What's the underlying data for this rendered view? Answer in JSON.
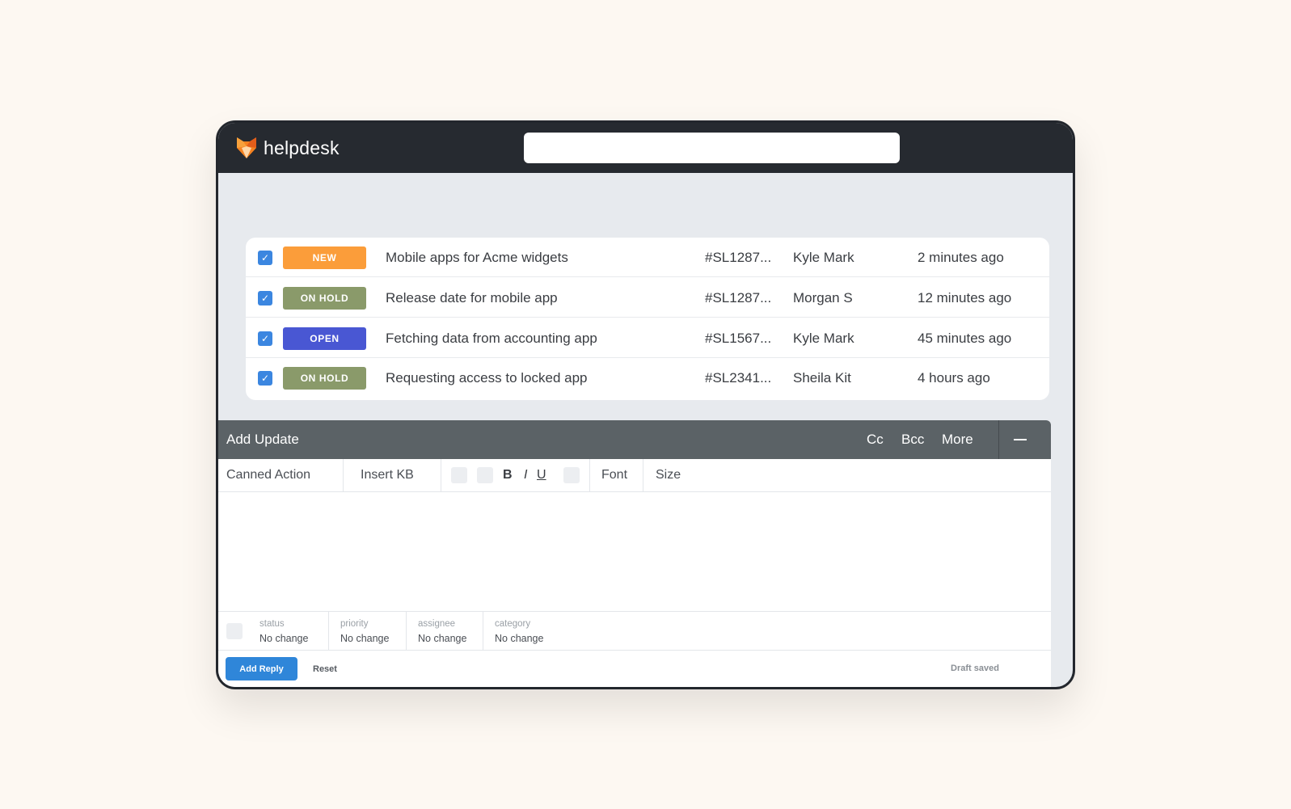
{
  "app": {
    "brand": "helpdesk",
    "logo_icon": "fox-logo-icon"
  },
  "search": {
    "value": "",
    "placeholder": ""
  },
  "colors": {
    "topbar": "#262a30",
    "badge_new": "#fb9d3a",
    "badge_on_hold": "#8a9a6a",
    "badge_open": "#4957d3",
    "primary": "#2f86d9"
  },
  "tickets": [
    {
      "checked": true,
      "status": "NEW",
      "status_color": "#fb9d3a",
      "subject": "Mobile apps for Acme widgets",
      "id": "#SL1287...",
      "requester": "Kyle Mark",
      "updated": "2 minutes ago"
    },
    {
      "checked": true,
      "status": "ON HOLD",
      "status_color": "#8a9a6a",
      "subject": "Release date for mobile app",
      "id": "#SL1287...",
      "requester": "Morgan S",
      "updated": "12 minutes ago"
    },
    {
      "checked": true,
      "status": "OPEN",
      "status_color": "#4957d3",
      "subject": "Fetching data from accounting app",
      "id": "#SL1567...",
      "requester": "Kyle Mark",
      "updated": "45 minutes ago"
    },
    {
      "checked": true,
      "status": "ON HOLD",
      "status_color": "#8a9a6a",
      "subject": "Requesting access to locked app",
      "id": "#SL2341...",
      "requester": "Sheila Kit",
      "updated": "4 hours ago"
    }
  ],
  "composer": {
    "title": "Add Update",
    "header_actions": {
      "cc": "Cc",
      "bcc": "Bcc",
      "more": "More",
      "minimize_icon": "minus-icon"
    },
    "toolbar": {
      "canned_action": "Canned Action",
      "insert_kb": "Insert KB",
      "bold": "B",
      "italic": "I",
      "underline": "U",
      "font": "Font",
      "size": "Size"
    },
    "fields": [
      {
        "label": "status",
        "value": "No change"
      },
      {
        "label": "priority",
        "value": "No change"
      },
      {
        "label": "assignee",
        "value": "No change"
      },
      {
        "label": "category",
        "value": "No change"
      }
    ],
    "add_reply": "Add Reply",
    "reset": "Reset",
    "draft_status": "Draft saved"
  }
}
